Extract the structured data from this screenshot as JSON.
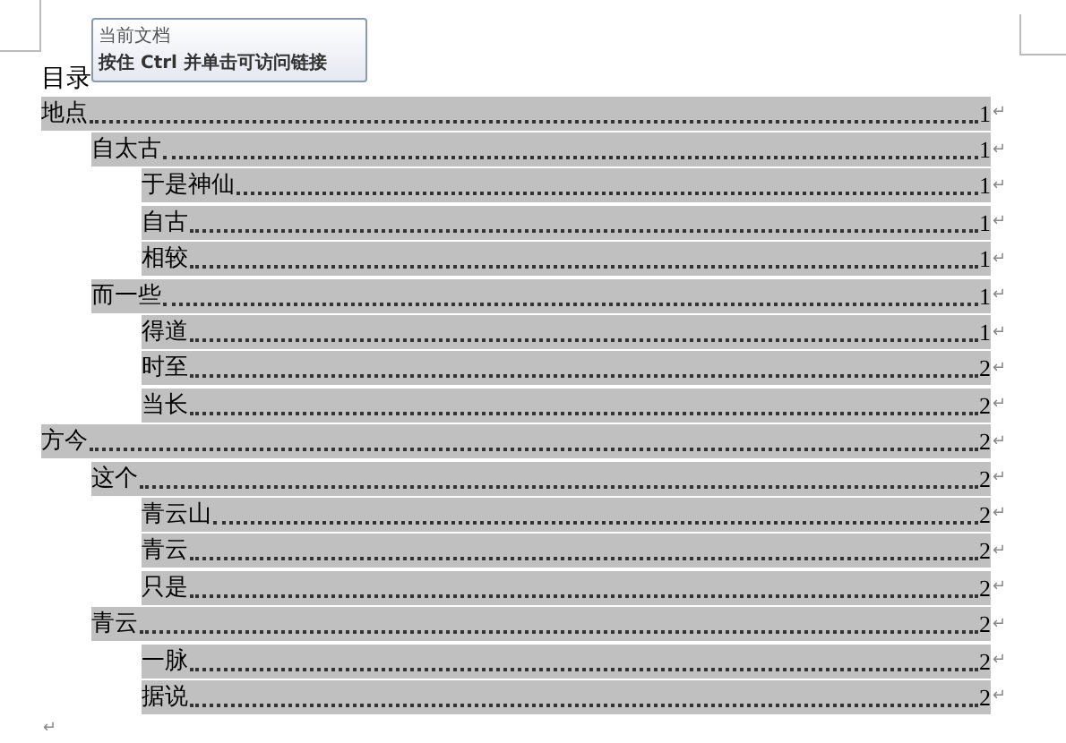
{
  "tooltip": {
    "title": "当前文档",
    "hint": "按住 Ctrl 并单击可访问链接"
  },
  "toc": {
    "heading": "目录",
    "entries": [
      {
        "title": "地点",
        "page": "1",
        "end": "↵",
        "children": [
          {
            "title": "自太古",
            "page": "1",
            "end": "↵",
            "children": [
              {
                "title": "于是神仙",
                "page": "1",
                "end": "↵"
              },
              {
                "title": "自古",
                "page": "1",
                "end": "↵"
              },
              {
                "title": "相较",
                "page": "1",
                "end": "↵"
              }
            ]
          },
          {
            "title": "而一些",
            "page": "1",
            "end": "↵",
            "children": [
              {
                "title": "得道",
                "page": "1",
                "end": "↵"
              },
              {
                "title": "时至",
                "page": "2",
                "end": "↵"
              },
              {
                "title": "当长",
                "page": "2",
                "end": "↵"
              }
            ]
          }
        ]
      },
      {
        "title": "方今",
        "page": "2",
        "end": "↵",
        "children": [
          {
            "title": "这个",
            "page": "2",
            "end": "↵",
            "children": [
              {
                "title": "青云山",
                "page": "2",
                "end": "↵"
              },
              {
                "title": "青云",
                "page": "2",
                "end": "↵"
              },
              {
                "title": "只是",
                "page": "2",
                "end": "↵"
              }
            ]
          },
          {
            "title": "青云",
            "page": "2",
            "end": "↵",
            "children": [
              {
                "title": "一脉",
                "page": "2",
                "end": "↵"
              },
              {
                "title": "据说",
                "page": "2",
                "end": "↵"
              }
            ]
          }
        ]
      }
    ]
  },
  "final_mark": "↵"
}
